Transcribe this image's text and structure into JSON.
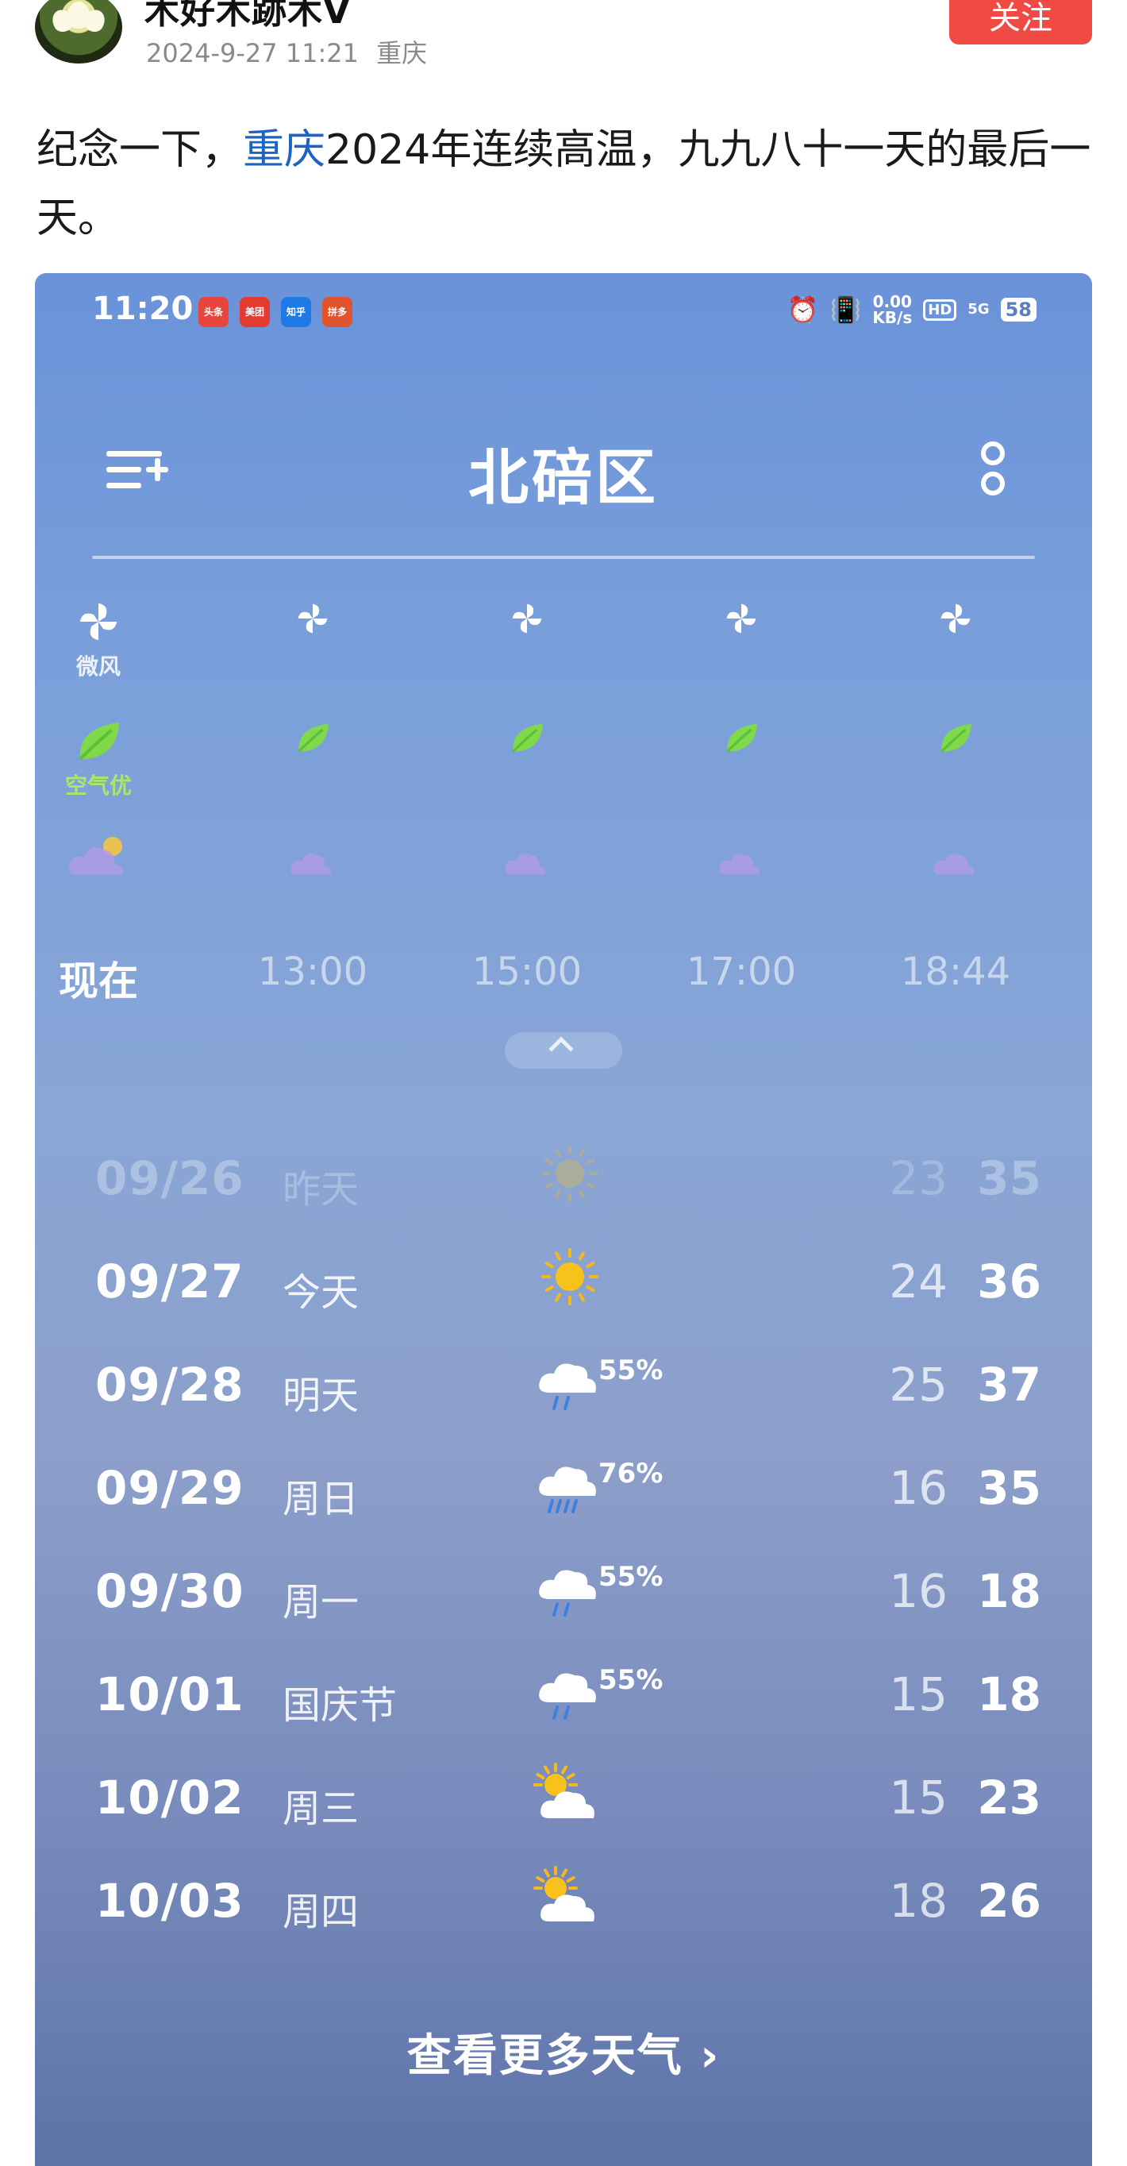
{
  "post": {
    "author": "木好木跡木V",
    "date": "2024-9-27 11:21",
    "location": "重庆",
    "follow_label": "关注",
    "text_before": "纪念一下，",
    "topic": "重庆",
    "text_after": "2024年连续高温，九九八十一天的最后一天。"
  },
  "phone": {
    "status_time": "11:20",
    "status_apps": [
      "头条",
      "美团",
      "知乎",
      "拼多"
    ],
    "net_speed_top": "0.00",
    "net_speed_unit": "KB/s",
    "hd": "HD",
    "signal": "5G",
    "battery": "58",
    "city": "北碚区",
    "hourly": [
      {
        "time": "现在",
        "wind": "微风",
        "aqi": "空气优",
        "now": true
      },
      {
        "time": "13:00"
      },
      {
        "time": "15:00"
      },
      {
        "time": "17:00"
      },
      {
        "time": "18:44"
      }
    ],
    "daily": [
      {
        "date": "09/26",
        "name": "昨天",
        "icon": "sun-icon",
        "pop": "",
        "low": "23",
        "high": "35",
        "faded": true
      },
      {
        "date": "09/27",
        "name": "今天",
        "icon": "sun-icon",
        "pop": "",
        "low": "24",
        "high": "36"
      },
      {
        "date": "09/28",
        "name": "明天",
        "icon": "rain-cloud-icon",
        "pop": "55%",
        "low": "25",
        "high": "37"
      },
      {
        "date": "09/29",
        "name": "周日",
        "icon": "heavy-rain-cloud-icon",
        "pop": "76%",
        "low": "16",
        "high": "35"
      },
      {
        "date": "09/30",
        "name": "周一",
        "icon": "rain-cloud-icon",
        "pop": "55%",
        "low": "16",
        "high": "18"
      },
      {
        "date": "10/01",
        "name": "国庆节",
        "icon": "rain-cloud-icon",
        "pop": "55%",
        "low": "15",
        "high": "18"
      },
      {
        "date": "10/02",
        "name": "周三",
        "icon": "partly-cloudy-icon",
        "pop": "",
        "low": "15",
        "high": "23"
      },
      {
        "date": "10/03",
        "name": "周四",
        "icon": "partly-cloudy-icon",
        "pop": "",
        "low": "18",
        "high": "26"
      }
    ],
    "more_weather": "查看更多天气"
  },
  "colors": {
    "follow": "#f04a44",
    "topic": "#1d63c4",
    "aqi_good": "#7fd94a"
  }
}
